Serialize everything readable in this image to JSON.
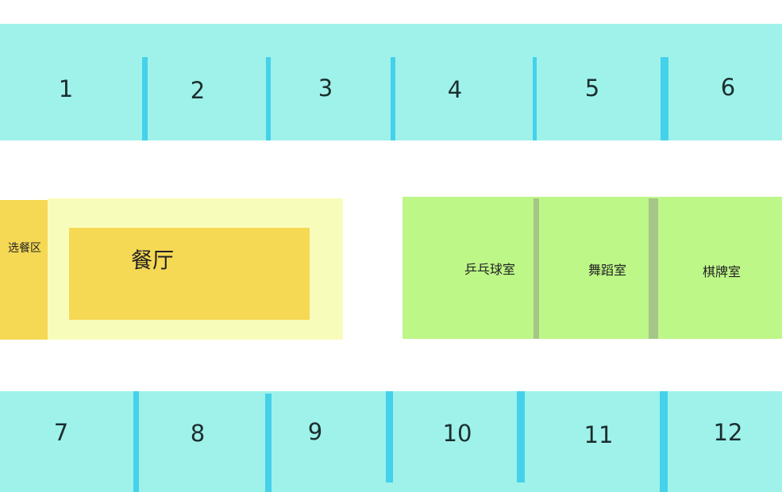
{
  "colors": {
    "room_band": "#9ef2ea",
    "room_divider": "#45d1ea",
    "dining_outer": "#f8fcbb",
    "dining_inner": "#f5d955",
    "activity": "#bdf788",
    "activity_divider": "#a6c589"
  },
  "rooms_top": [
    "1",
    "2",
    "3",
    "4",
    "5",
    "6"
  ],
  "rooms_bottom": [
    "7",
    "8",
    "9",
    "10",
    "11",
    "12"
  ],
  "dining": {
    "serving_label": "选餐区",
    "hall_label": "餐厅"
  },
  "activity_rooms": [
    "乒乓球室",
    "舞蹈室",
    "棋牌室"
  ]
}
